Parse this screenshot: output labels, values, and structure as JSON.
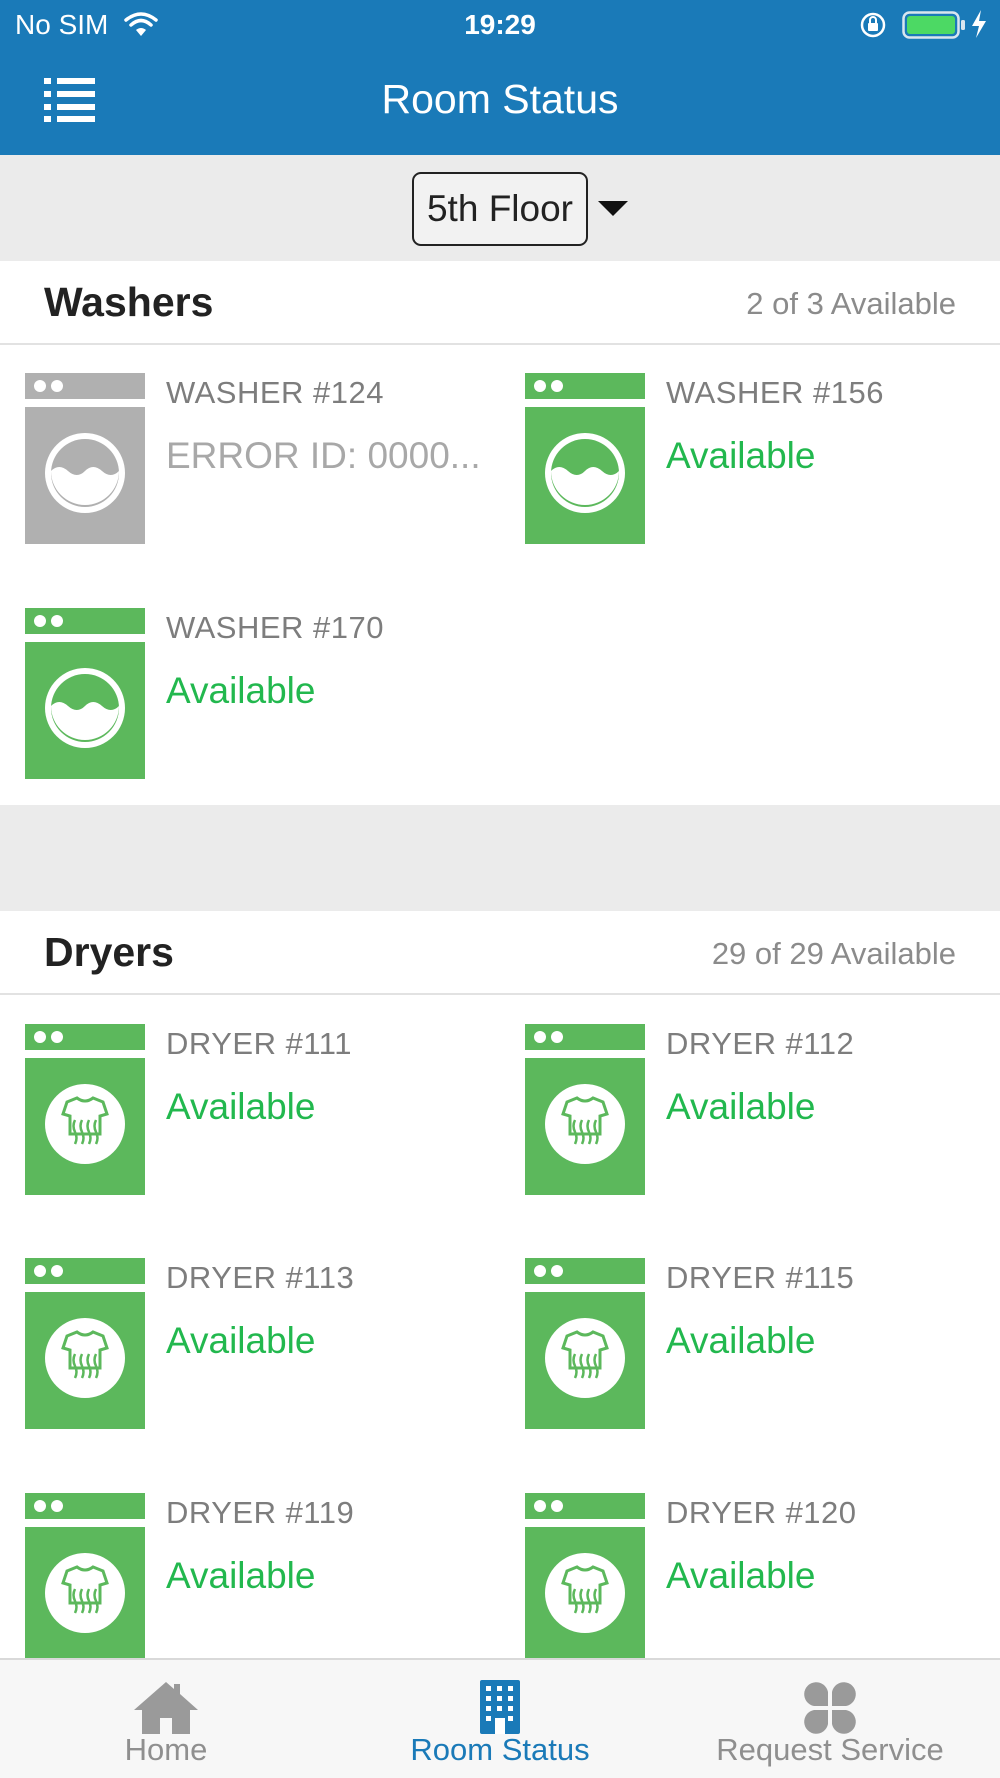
{
  "status_bar": {
    "carrier": "No SIM",
    "time": "19:29"
  },
  "header": {
    "title": "Room Status"
  },
  "floor_selector": {
    "selected": "5th Floor"
  },
  "washers": {
    "title": "Washers",
    "count": "2 of 3 Available",
    "items": [
      {
        "name": "WASHER #124",
        "status": "ERROR ID: 0000...",
        "state": "error"
      },
      {
        "name": "WASHER #156",
        "status": "Available",
        "state": "available"
      },
      {
        "name": "WASHER #170",
        "status": "Available",
        "state": "available"
      }
    ]
  },
  "dryers": {
    "title": "Dryers",
    "count": "29 of 29 Available",
    "items": [
      {
        "name": "DRYER #111",
        "status": "Available",
        "state": "available"
      },
      {
        "name": "DRYER #112",
        "status": "Available",
        "state": "available"
      },
      {
        "name": "DRYER #113",
        "status": "Available",
        "state": "available"
      },
      {
        "name": "DRYER #115",
        "status": "Available",
        "state": "available"
      },
      {
        "name": "DRYER #119",
        "status": "Available",
        "state": "available"
      },
      {
        "name": "DRYER #120",
        "status": "Available",
        "state": "available"
      }
    ]
  },
  "tabs": [
    {
      "label": "Home",
      "icon": "home-icon",
      "active": false
    },
    {
      "label": "Room Status",
      "icon": "building-icon",
      "active": true
    },
    {
      "label": "Request Service",
      "icon": "four-petal-icon",
      "active": false
    }
  ],
  "colors": {
    "brand": "#1a7ab8",
    "available_green": "#5cb85c",
    "available_text": "#22b84e",
    "error_grey": "#a8a8a8"
  }
}
